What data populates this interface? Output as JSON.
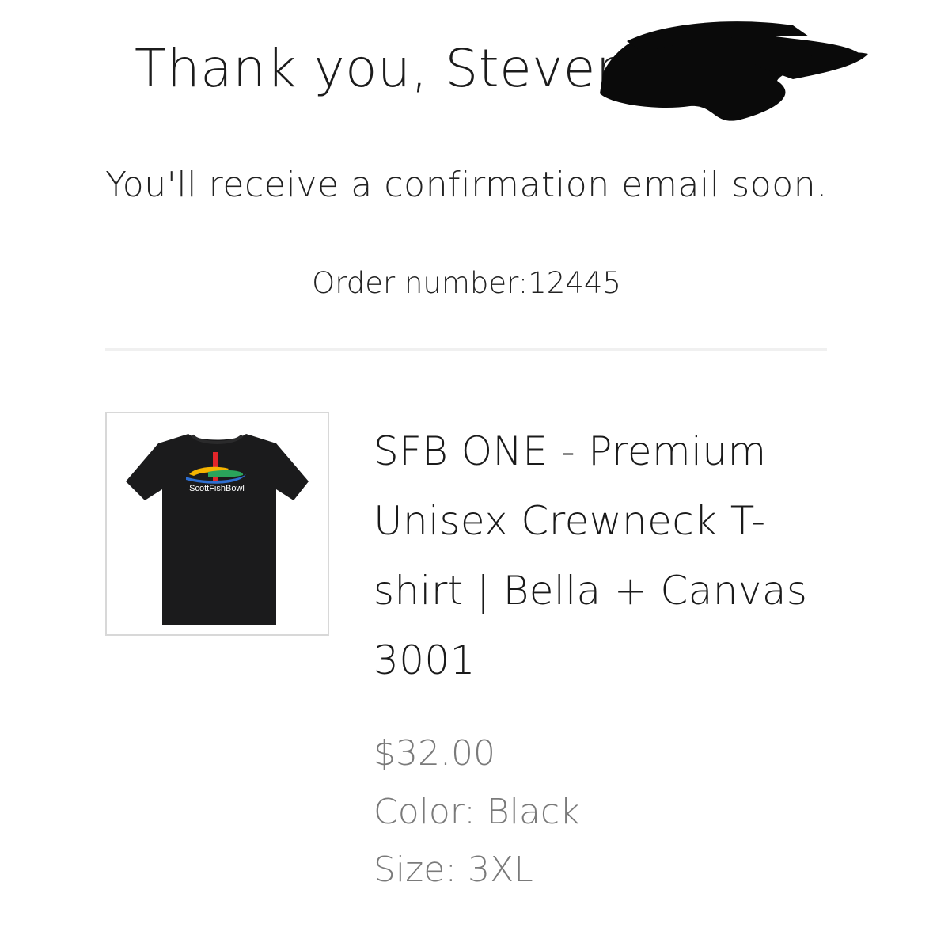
{
  "header": {
    "thank_you": "Thank you, Steven",
    "confirmation": "You'll receive a confirmation email soon.",
    "order_number": "Order number:12445"
  },
  "item": {
    "image_brand_text": "ScottFishBowl",
    "title": "SFB ONE - Premium Unisex Crewneck T-shirt | Bella + Canvas 3001",
    "price": "$32.00",
    "color": "Color: Black",
    "size": "Size: 3XL"
  },
  "colors": {
    "shirt": "#1b1b1c",
    "logo_red": "#e2262a",
    "logo_yellow": "#f5b400",
    "logo_green": "#2aa35b",
    "logo_blue": "#2f6fd1"
  }
}
